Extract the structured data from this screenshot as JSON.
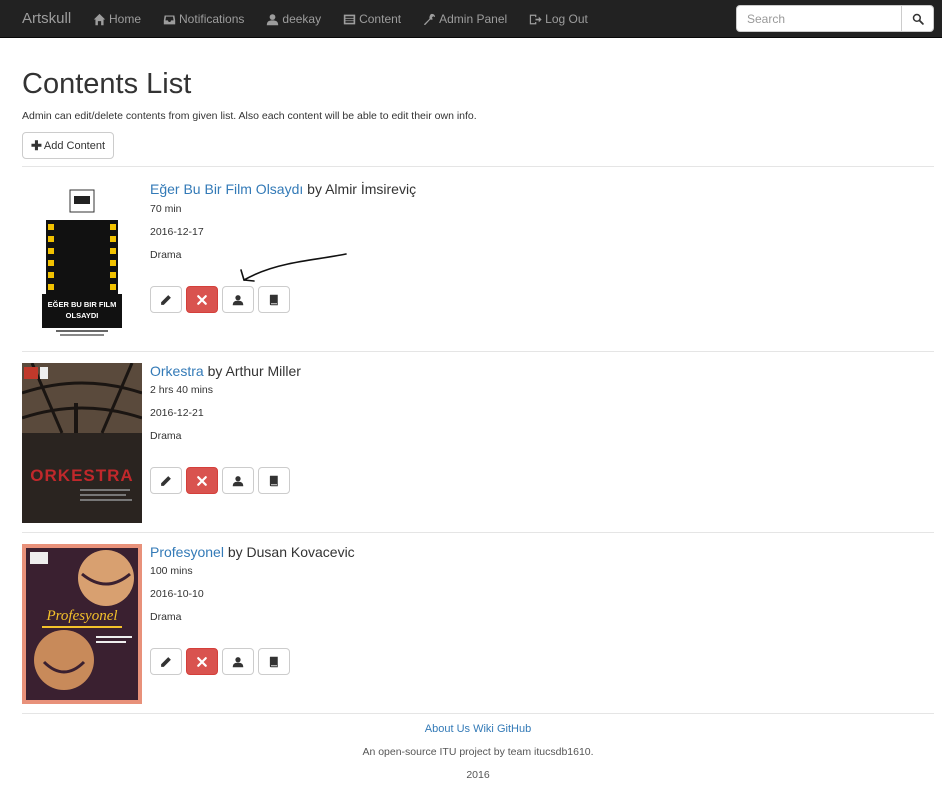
{
  "navbar": {
    "brand": "Artskull",
    "items": [
      {
        "label": "Home",
        "icon": "home-icon"
      },
      {
        "label": "Notifications",
        "icon": "inbox-icon"
      },
      {
        "label": "deekay",
        "icon": "user-icon"
      },
      {
        "label": "Content",
        "icon": "list-icon"
      },
      {
        "label": "Admin Panel",
        "icon": "wrench-icon"
      },
      {
        "label": "Log Out",
        "icon": "logout-icon"
      }
    ],
    "search_placeholder": "Search"
  },
  "page": {
    "title": "Contents List",
    "description": "Admin can edit/delete contents from given list. Also each content will be able to edit their own info.",
    "add_button": "Add Content"
  },
  "contents": [
    {
      "title": "Eğer Bu Bir Film Olsaydı",
      "by": "by",
      "author": "Almir İmsireviç",
      "duration": "70 min",
      "date": "2016-12-17",
      "genre": "Drama",
      "poster_text": "EĞER BU BIR FILM OLSAYDI"
    },
    {
      "title": "Orkestra",
      "by": "by",
      "author": "Arthur Miller",
      "duration": "2 hrs 40 mins",
      "date": "2016-12-21",
      "genre": "Drama",
      "poster_text": "ORKESTRA"
    },
    {
      "title": "Profesyonel",
      "by": "by",
      "author": "Dusan Kovacevic",
      "duration": "100 mins",
      "date": "2016-10-10",
      "genre": "Drama",
      "poster_text": "Profesyonel"
    }
  ],
  "footer": {
    "links": [
      "About Us",
      "Wiki",
      "GitHub"
    ],
    "note": "An open-source ITU project by team itucsdb1610.",
    "year": "2016"
  },
  "colors": {
    "navbar_bg": "#222222",
    "link": "#337ab7",
    "danger": "#d9534f"
  }
}
